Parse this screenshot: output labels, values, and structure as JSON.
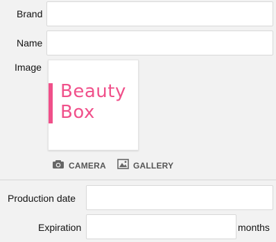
{
  "form": {
    "brand": {
      "label": "Brand",
      "value": ""
    },
    "name": {
      "label": "Name",
      "value": ""
    },
    "image": {
      "label": "Image",
      "logo_line1": "Beauty",
      "logo_line2": "Box"
    },
    "actions": {
      "camera_label": "CAMERA",
      "gallery_label": "GALLERY"
    },
    "production_date": {
      "label": "Production date",
      "value": ""
    },
    "expiration": {
      "label": "Expiration",
      "value": "",
      "unit": "months"
    }
  },
  "colors": {
    "logo_pink": "#f0508a",
    "icon_gray": "#666666"
  },
  "icons": {
    "camera": "camera-icon",
    "gallery": "gallery-icon"
  }
}
